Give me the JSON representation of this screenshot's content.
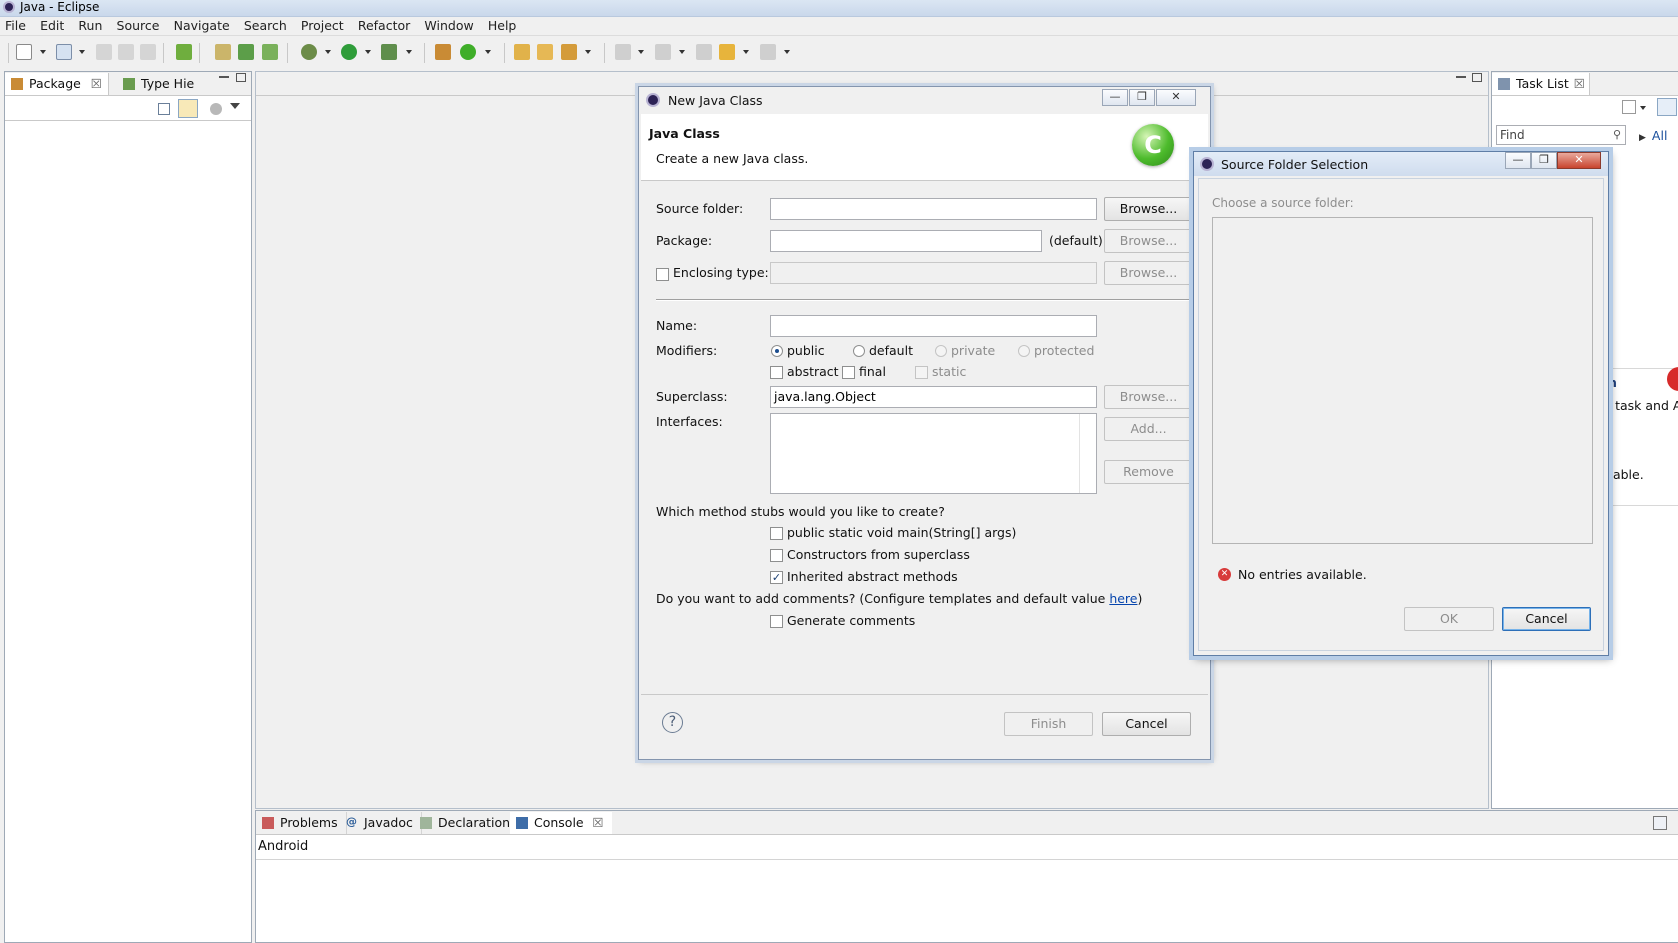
{
  "window": {
    "title": "Java - Eclipse"
  },
  "menu": [
    "File",
    "Edit",
    "Run",
    "Source",
    "Navigate",
    "Search",
    "Project",
    "Refactor",
    "Window",
    "Help"
  ],
  "left_panel": {
    "tabs": [
      "Package",
      "Type Hie"
    ]
  },
  "task_list": {
    "tab": "Task List",
    "find_placeholder": "Find",
    "all_label": "All",
    "partial_text_1": "n",
    "partial_text_2": "r task and A",
    "partial_text_3": "ilable."
  },
  "bottom_panel": {
    "tabs": [
      "Problems",
      "Javadoc",
      "Declaration",
      "Console"
    ],
    "console_text": "Android"
  },
  "new_java_class": {
    "title": "New Java Class",
    "heading": "Java Class",
    "description": "Create a new Java class.",
    "labels": {
      "source_folder": "Source folder:",
      "package": "Package:",
      "package_default": "(default)",
      "enclosing_type": "Enclosing type:",
      "name": "Name:",
      "modifiers": "Modifiers:",
      "superclass": "Superclass:",
      "interfaces": "Interfaces:",
      "stubs_question": "Which method stubs would you like to create?",
      "comments_question_pre": "Do you want to add comments? (Configure templates and default value ",
      "comments_link": "here",
      "comments_question_post": ")"
    },
    "values": {
      "source_folder": "",
      "package": "",
      "enclosing_type": "",
      "name": "",
      "superclass": "java.lang.Object"
    },
    "modifiers": {
      "public": "public",
      "default": "default",
      "private": "private",
      "protected": "protected",
      "abstract": "abstract",
      "final": "final",
      "static": "static",
      "selected": "public"
    },
    "stubs": [
      {
        "label": "public static void main(String[] args)",
        "checked": false
      },
      {
        "label": "Constructors from superclass",
        "checked": false
      },
      {
        "label": "Inherited abstract methods",
        "checked": true
      }
    ],
    "generate_comments": {
      "label": "Generate comments",
      "checked": false
    },
    "buttons": {
      "browse": "Browse...",
      "add": "Add...",
      "remove": "Remove",
      "finish": "Finish",
      "cancel": "Cancel"
    }
  },
  "source_folder_selection": {
    "title": "Source Folder Selection",
    "prompt": "Choose a source folder:",
    "error": "No entries available.",
    "ok": "OK",
    "cancel": "Cancel"
  },
  "colors": {
    "accent": "#2d6fb8",
    "error": "#d83b3b",
    "link": "#0645ad",
    "class_icon": "#3fae29"
  }
}
